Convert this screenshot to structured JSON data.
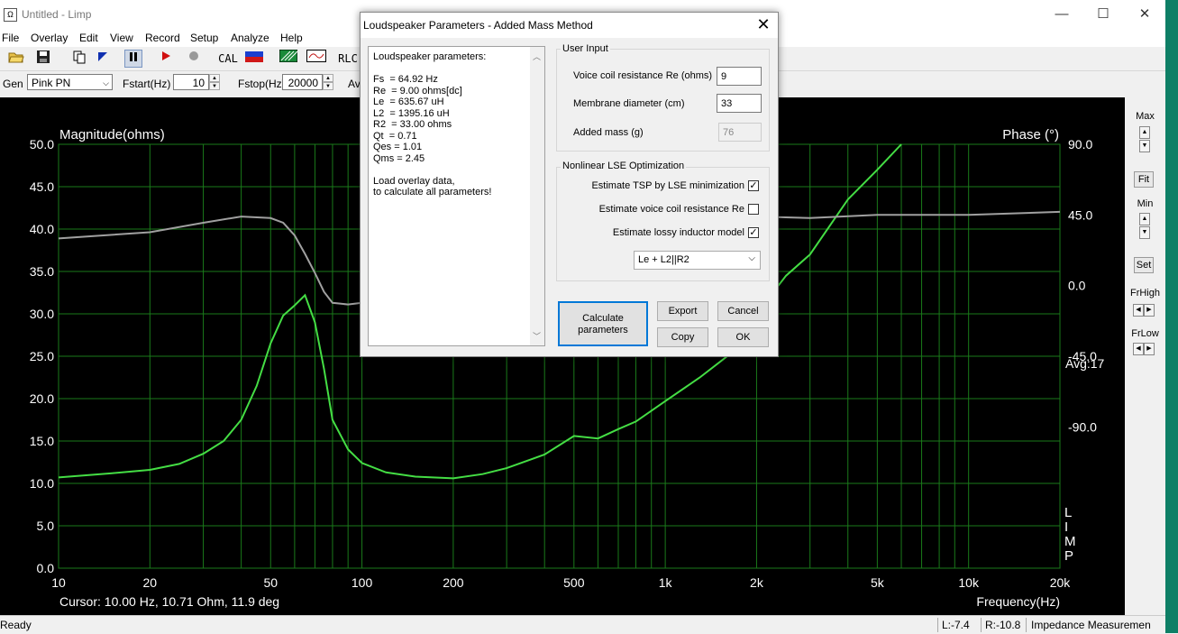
{
  "window": {
    "app_icon": "Ω",
    "title": "Untitled - Limp",
    "min_icon": "—",
    "max_icon": "☐",
    "close_icon": "✕"
  },
  "menu": [
    "File",
    "Overlay",
    "Edit",
    "View",
    "Record",
    "Setup",
    "Analyze",
    "Help"
  ],
  "toolbar": {
    "cal_label": "CAL",
    "rlc_label": "RLC"
  },
  "gen_row": {
    "gen_label": "Gen",
    "gen_value": "Pink PN",
    "fstart_label": "Fstart(Hz)",
    "fstart_value": "10",
    "fstop_label": "Fstop(Hz)",
    "fstop_value": "20000",
    "avg_label": "Av"
  },
  "plot": {
    "left_title": "Magnitude(ohms)",
    "right_title": "Phase (°)",
    "y_ticks": [
      "50.0",
      "45.0",
      "40.0",
      "35.0",
      "30.0",
      "25.0",
      "20.0",
      "15.0",
      "10.0",
      "5.0",
      "0.0"
    ],
    "phase_ticks": [
      "90.0",
      "45.0",
      "0.0",
      "-45.0",
      "-90.0"
    ],
    "x_ticks": [
      "10",
      "20",
      "50",
      "100",
      "200",
      "500",
      "1k",
      "2k",
      "5k",
      "10k",
      "20k"
    ],
    "avg_text": "Avg:17",
    "vertical_brand": [
      "L",
      "I",
      "M",
      "P"
    ],
    "cursor_text": "Cursor: 10.00 Hz, 10.71 Ohm, 11.9 deg",
    "xaxis_label": "Frequency(Hz)"
  },
  "chart_data": {
    "type": "line",
    "title": "",
    "xlabel": "Frequency(Hz)",
    "ylabel": "Magnitude(ohms)",
    "y2label": "Phase (°)",
    "xscale": "log",
    "xlim": [
      10,
      20000
    ],
    "ylim": [
      0,
      50
    ],
    "y2lim": [
      -180,
      90
    ],
    "grid": true,
    "series": [
      {
        "axis": "left",
        "color": "#44dd44",
        "x": [
          10,
          15,
          20,
          25,
          30,
          35,
          40,
          45,
          50,
          55,
          60,
          64.9,
          70,
          75,
          80,
          90,
          100,
          120,
          150,
          200,
          250,
          300,
          400,
          500,
          600,
          700,
          800,
          1000,
          1300,
          1600,
          2000,
          2500,
          3000,
          4000,
          5000,
          6000
        ],
        "values": [
          10.7,
          11.2,
          11.6,
          12.3,
          13.5,
          15.0,
          17.5,
          21.5,
          26.5,
          29.8,
          31.0,
          32.2,
          29.0,
          23.5,
          17.5,
          14.0,
          12.4,
          11.3,
          10.8,
          10.6,
          11.1,
          11.8,
          13.4,
          15.6,
          15.3,
          16.4,
          17.3,
          19.7,
          22.5,
          25.0,
          30.0,
          34.5,
          37.0,
          43.5,
          47.0,
          50.0
        ]
      },
      {
        "axis": "right",
        "color": "#a0a0a0",
        "x": [
          10,
          20,
          30,
          40,
          50,
          55,
          60,
          65,
          70,
          75,
          80,
          90,
          100,
          1500,
          2000,
          3000,
          5000,
          10000,
          20000
        ],
        "values": [
          30,
          34,
          40,
          44,
          43,
          40,
          32,
          20,
          8,
          -4,
          -11,
          -12,
          -11,
          45,
          44,
          43,
          45,
          45,
          47
        ]
      }
    ]
  },
  "right_panel": {
    "max_label": "Max",
    "fit_label": "Fit",
    "min_label": "Min",
    "set_label": "Set",
    "frhigh_label": "FrHigh",
    "frlow_label": "FrLow"
  },
  "status": {
    "ready": "Ready",
    "l_value": "L:-7.4",
    "r_value": "R:-10.8",
    "mode": "Impedance Measuremen"
  },
  "dialog": {
    "title": "Loudspeaker Parameters - Added Mass Method",
    "results": "Loudspeaker parameters:\n\nFs  = 64.92 Hz\nRe  = 9.00 ohms[dc]\nLe  = 635.67 uH\nL2  = 1395.16 uH\nR2  = 33.00 ohms\nQt  = 0.71\nQes = 1.01\nQms = 2.45\n\nLoad overlay data,\nto calculate all parameters!",
    "user_input_group": "User Input",
    "re_label": "Voice coil resistance Re (ohms)",
    "re_value": "9",
    "diam_label": "Membrane diameter (cm)",
    "diam_value": "33",
    "mass_label": "Added mass (g)",
    "mass_value": "76",
    "lse_group": "Nonlinear LSE Optimization",
    "chk_tsp_label": "Estimate TSP by LSE minimization",
    "chk_tsp_checked": true,
    "chk_re_label": "Estimate voice coil resistance Re",
    "chk_re_checked": false,
    "chk_lossy_label": "Estimate lossy inductor model",
    "chk_lossy_checked": true,
    "model_value": "Le + L2||R2",
    "calc_label": "Calculate\nparameters",
    "export_label": "Export",
    "cancel_label": "Cancel",
    "copy_label": "Copy",
    "ok_label": "OK"
  }
}
